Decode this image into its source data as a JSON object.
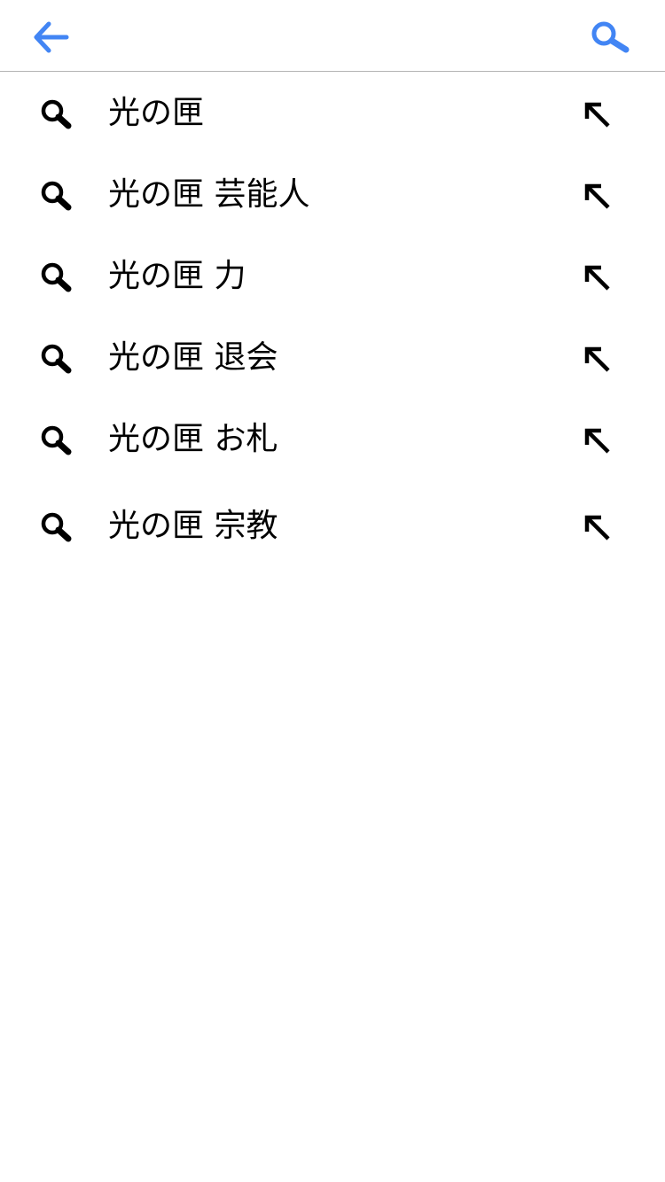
{
  "header": {
    "back_icon": "arrow-left-icon",
    "search_icon": "search-icon",
    "accent_color": "#4285f4"
  },
  "suggestions": [
    {
      "text": "光の匣"
    },
    {
      "text": "光の匣 芸能人"
    },
    {
      "text": "光の匣 力"
    },
    {
      "text": "光の匣 退会"
    },
    {
      "text": "光の匣 お札"
    },
    {
      "text": "光の匣 宗教"
    }
  ],
  "icons": {
    "row_leading": "search-icon",
    "row_trailing": "arrow-up-left-icon"
  }
}
